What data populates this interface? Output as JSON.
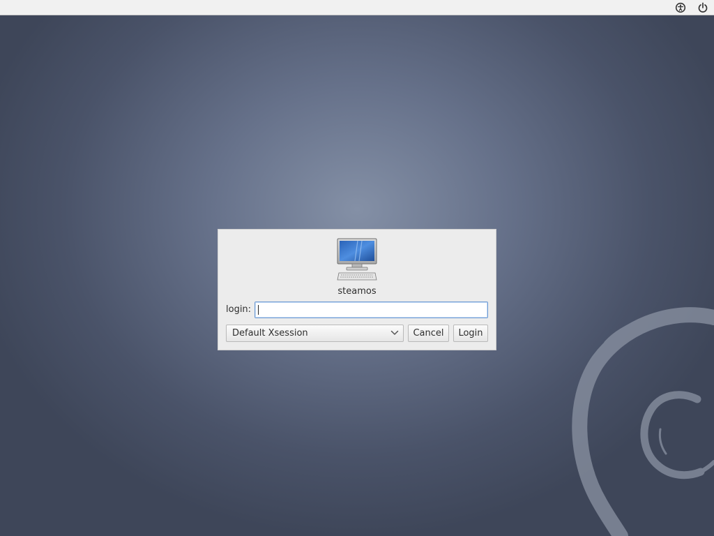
{
  "topbar": {
    "accessibility_icon": "accessibility-icon",
    "power_icon": "power-icon"
  },
  "dialog": {
    "host_icon": "computer-icon",
    "hostname": "steamos",
    "login_label": "login:",
    "login_value": "",
    "session_selected": "Default Xsession",
    "cancel_label": "Cancel",
    "login_button_label": "Login"
  },
  "wallpaper": {
    "logo": "debian-swirl"
  },
  "colors": {
    "topbar_bg": "#f1f1f1",
    "desktop_center": "#8490a6",
    "desktop_edge": "#3e4659",
    "dialog_bg": "#ececec",
    "focus_border": "#6f9bd3"
  }
}
